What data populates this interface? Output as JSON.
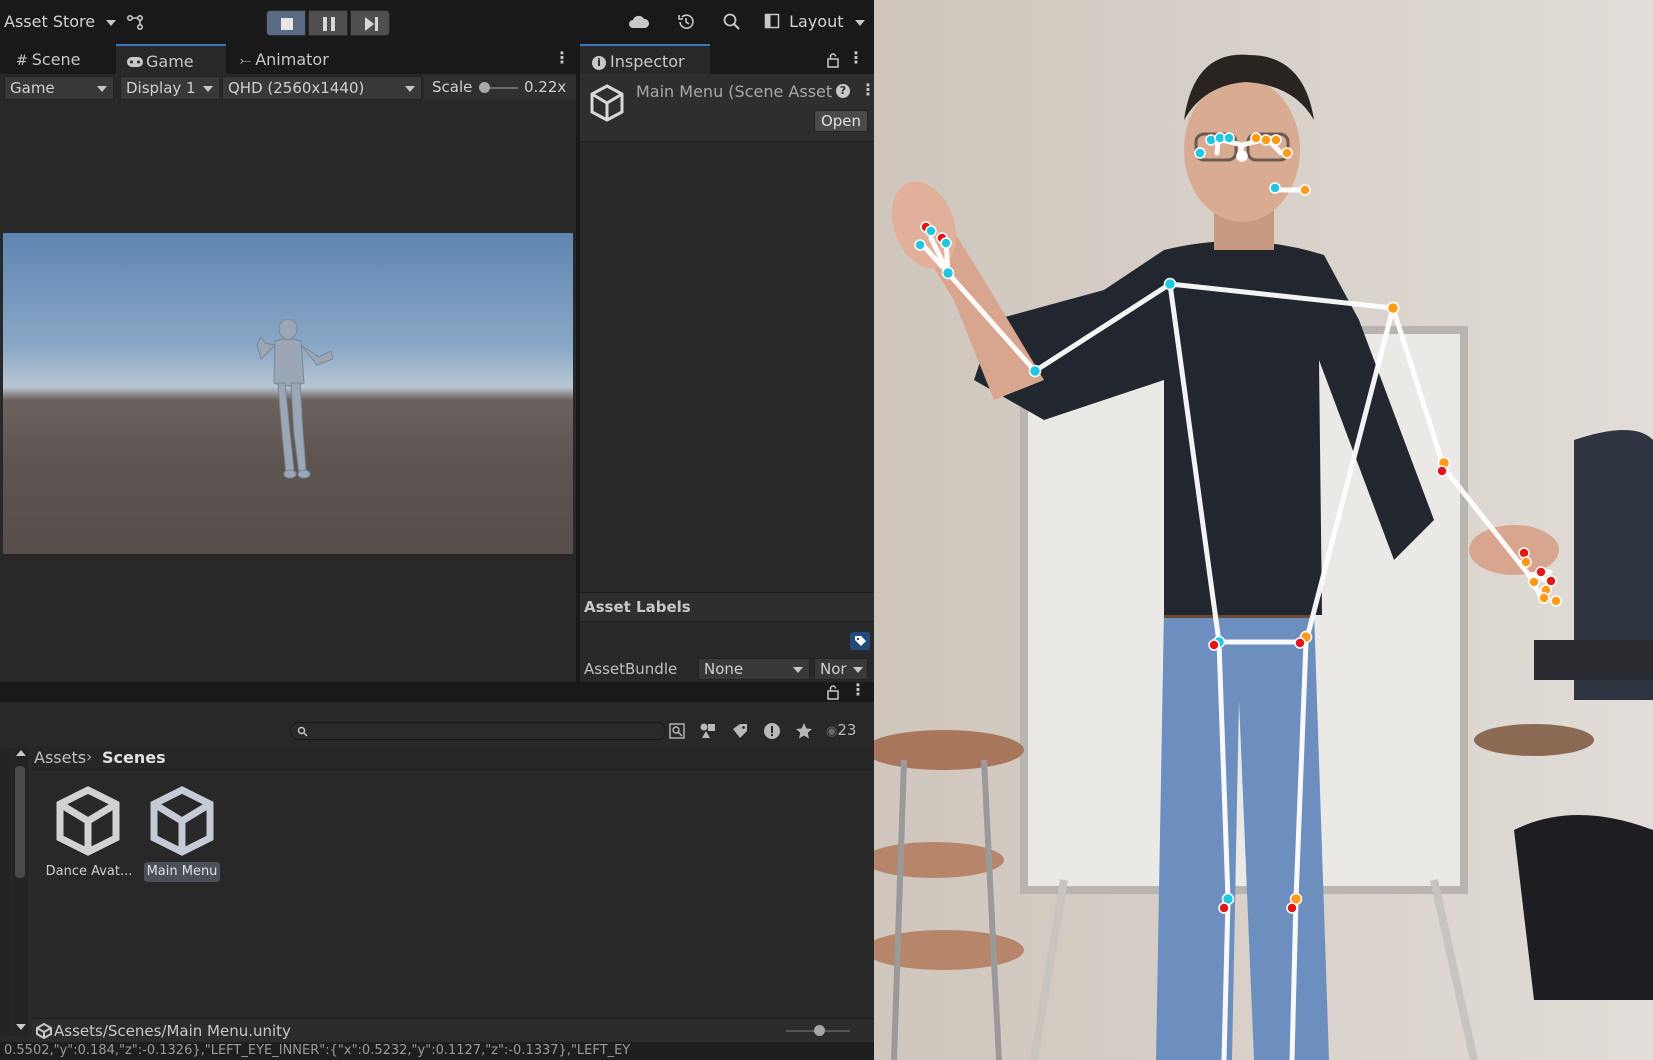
{
  "toolbar": {
    "asset_store": "Asset Store",
    "layout": "Layout"
  },
  "game_tabs": {
    "scene": "Scene",
    "game": "Game",
    "animator": "Animator"
  },
  "game_controls": {
    "mode": "Game",
    "display": "Display 1",
    "resolution": "QHD (2560x1440)",
    "scale_label": "Scale",
    "scale_value": "0.22x"
  },
  "inspector": {
    "tab": "Inspector",
    "title": "Main Menu (Scene Asset",
    "open_button": "Open",
    "asset_labels": "Asset Labels",
    "assetbundle_label": "AssetBundle",
    "assetbundle_value": "None",
    "variant_value": "Nor"
  },
  "project": {
    "hidden_count": "23",
    "breadcrumb_root": "Assets",
    "breadcrumb_current": "Scenes",
    "assets": [
      {
        "label": "Dance Avat..."
      },
      {
        "label": "Main Menu"
      }
    ],
    "status_path": "Assets/Scenes/Main Menu.unity"
  },
  "console": {
    "line": "0.5502,\"y\":0.184,\"z\":-0.1326},\"LEFT_EYE_INNER\":{\"x\":0.5232,\"y\":0.1127,\"z\":-0.1337},\"LEFT_EY"
  },
  "colors": {
    "accent": "#3a79bb",
    "landmark_left": "#1ec8e0",
    "landmark_right": "#ff9a1a",
    "landmark_red": "#e01818",
    "skeleton": "#ffffff"
  }
}
